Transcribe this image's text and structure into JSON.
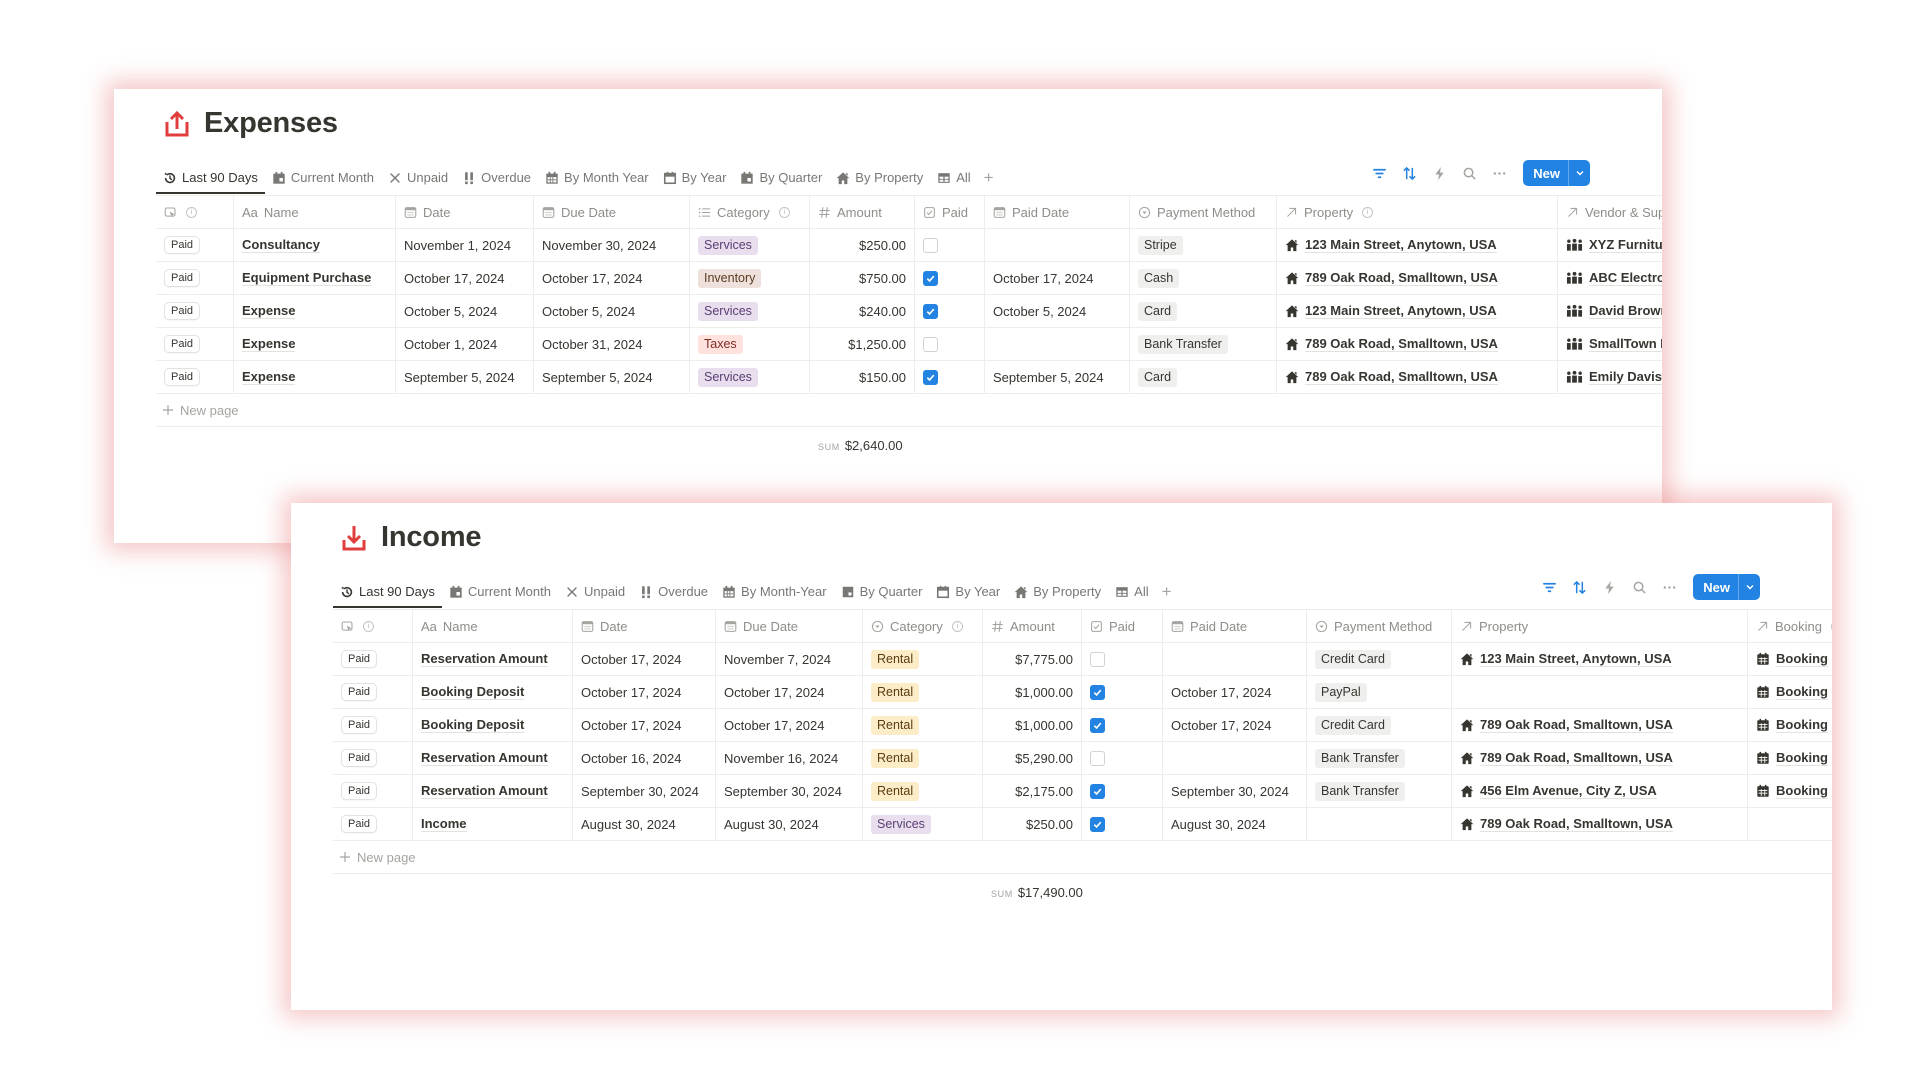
{
  "expenses": {
    "title": "Expenses",
    "icon": "upload-box-icon",
    "views": [
      {
        "label": "Last 90 Days",
        "icon": "history-icon",
        "active": true
      },
      {
        "label": "Current Month",
        "icon": "calendar-page-icon"
      },
      {
        "label": "Unpaid",
        "icon": "x-icon"
      },
      {
        "label": "Overdue",
        "icon": "double-exclamation-icon"
      },
      {
        "label": "By Month Year",
        "icon": "calendar-grid-icon"
      },
      {
        "label": "By Year",
        "icon": "calendar-icon"
      },
      {
        "label": "By Quarter",
        "icon": "calendar-page-icon"
      },
      {
        "label": "By Property",
        "icon": "house-icon"
      },
      {
        "label": "All",
        "icon": "table-icon"
      }
    ],
    "toolbar": {
      "new_label": "New"
    },
    "columns": [
      "",
      "Name",
      "Date",
      "Due Date",
      "Category",
      "Amount",
      "Paid",
      "Paid Date",
      "Payment Method",
      "Property",
      "Vendor & Supp"
    ],
    "rows": [
      {
        "status": "Paid",
        "name": "Consultancy",
        "date": "November 1, 2024",
        "due": "November 30, 2024",
        "category": "Services",
        "amount": "$250.00",
        "paid": false,
        "paid_date": "",
        "method": "Stripe",
        "property": "123 Main Street, Anytown, USA",
        "vendor": "XYZ Furniture"
      },
      {
        "status": "Paid",
        "name": "Equipment Purchase",
        "date": "October 17, 2024",
        "due": "October 17, 2024",
        "category": "Inventory",
        "amount": "$750.00",
        "paid": true,
        "paid_date": "October 17, 2024",
        "method": "Cash",
        "property": "789 Oak Road, Smalltown, USA",
        "vendor": "ABC Electronic"
      },
      {
        "status": "Paid",
        "name": "Expense",
        "date": "October 5, 2024",
        "due": "October 5, 2024",
        "category": "Services",
        "amount": "$240.00",
        "paid": true,
        "paid_date": "October 5, 2024",
        "method": "Card",
        "property": "123 Main Street, Anytown, USA",
        "vendor": "David Brown"
      },
      {
        "status": "Paid",
        "name": "Expense",
        "date": "October 1, 2024",
        "due": "October 31, 2024",
        "category": "Taxes",
        "amount": "$1,250.00",
        "paid": false,
        "paid_date": "",
        "method": "Bank Transfer",
        "property": "789 Oak Road, Smalltown, USA",
        "vendor": "SmallTown Mu"
      },
      {
        "status": "Paid",
        "name": "Expense",
        "date": "September 5, 2024",
        "due": "September 5, 2024",
        "category": "Services",
        "amount": "$150.00",
        "paid": true,
        "paid_date": "September 5, 2024",
        "method": "Card",
        "property": "789 Oak Road, Smalltown, USA",
        "vendor": "Emily Davis"
      }
    ],
    "new_page_label": "New page",
    "sum_label": "SUM",
    "sum_value": "$2,640.00"
  },
  "income": {
    "title": "Income",
    "icon": "download-tray-icon",
    "views": [
      {
        "label": "Last 90 Days",
        "icon": "history-icon",
        "active": true
      },
      {
        "label": "Current Month",
        "icon": "calendar-page-icon"
      },
      {
        "label": "Unpaid",
        "icon": "x-icon"
      },
      {
        "label": "Overdue",
        "icon": "double-exclamation-icon"
      },
      {
        "label": "By Month-Year",
        "icon": "calendar-grid-icon"
      },
      {
        "label": "By Quarter",
        "icon": "square-icon"
      },
      {
        "label": "By Year",
        "icon": "calendar-icon"
      },
      {
        "label": "By Property",
        "icon": "house-icon"
      },
      {
        "label": "All",
        "icon": "table-icon"
      }
    ],
    "toolbar": {
      "new_label": "New"
    },
    "columns": [
      "",
      "Name",
      "Date",
      "Due Date",
      "Category",
      "Amount",
      "Paid",
      "Paid Date",
      "Payment Method",
      "Property",
      "Booking"
    ],
    "rows": [
      {
        "status": "Paid",
        "name": "Reservation Amount",
        "date": "October 17, 2024",
        "due": "November 7, 2024",
        "category": "Rental",
        "amount": "$7,775.00",
        "paid": false,
        "paid_date": "",
        "method": "Credit Card",
        "property": "123 Main Street, Anytown, USA",
        "booking": "Booking"
      },
      {
        "status": "Paid",
        "name": "Booking Deposit",
        "date": "October 17, 2024",
        "due": "October 17, 2024",
        "category": "Rental",
        "amount": "$1,000.00",
        "paid": true,
        "paid_date": "October 17, 2024",
        "method": "PayPal",
        "property": "",
        "booking": "Booking"
      },
      {
        "status": "Paid",
        "name": "Booking Deposit",
        "date": "October 17, 2024",
        "due": "October 17, 2024",
        "category": "Rental",
        "amount": "$1,000.00",
        "paid": true,
        "paid_date": "October 17, 2024",
        "method": "Credit Card",
        "property": "789 Oak Road, Smalltown, USA",
        "booking": "Booking"
      },
      {
        "status": "Paid",
        "name": "Reservation Amount",
        "date": "October 16, 2024",
        "due": "November 16, 2024",
        "category": "Rental",
        "amount": "$5,290.00",
        "paid": false,
        "paid_date": "",
        "method": "Bank Transfer",
        "property": "789 Oak Road, Smalltown, USA",
        "booking": "Booking"
      },
      {
        "status": "Paid",
        "name": "Reservation Amount",
        "date": "September 30, 2024",
        "due": "September 30, 2024",
        "category": "Rental",
        "amount": "$2,175.00",
        "paid": true,
        "paid_date": "September 30, 2024",
        "method": "Bank Transfer",
        "property": "456 Elm Avenue, City Z, USA",
        "booking": "Booking"
      },
      {
        "status": "Paid",
        "name": "Income",
        "date": "August 30, 2024",
        "due": "August 30, 2024",
        "category": "Services",
        "amount": "$250.00",
        "paid": true,
        "paid_date": "August 30, 2024",
        "method": "",
        "property": "789 Oak Road, Smalltown, USA",
        "booking": ""
      }
    ],
    "new_page_label": "New page",
    "sum_label": "SUM",
    "sum_value": "$17,490.00"
  },
  "colors": {
    "accent": "#2383e2",
    "title_icon": "#e03e3e",
    "shadow": "#e88282",
    "tag_services_bg": "#e8deee",
    "tag_services_fg": "#5a3f73",
    "tag_inventory_bg": "#eee0da",
    "tag_inventory_fg": "#5c3b23",
    "tag_taxes_bg": "#ffe2dd",
    "tag_taxes_fg": "#812c22",
    "tag_rental_bg": "#fdecc8",
    "tag_rental_fg": "#593d11"
  }
}
